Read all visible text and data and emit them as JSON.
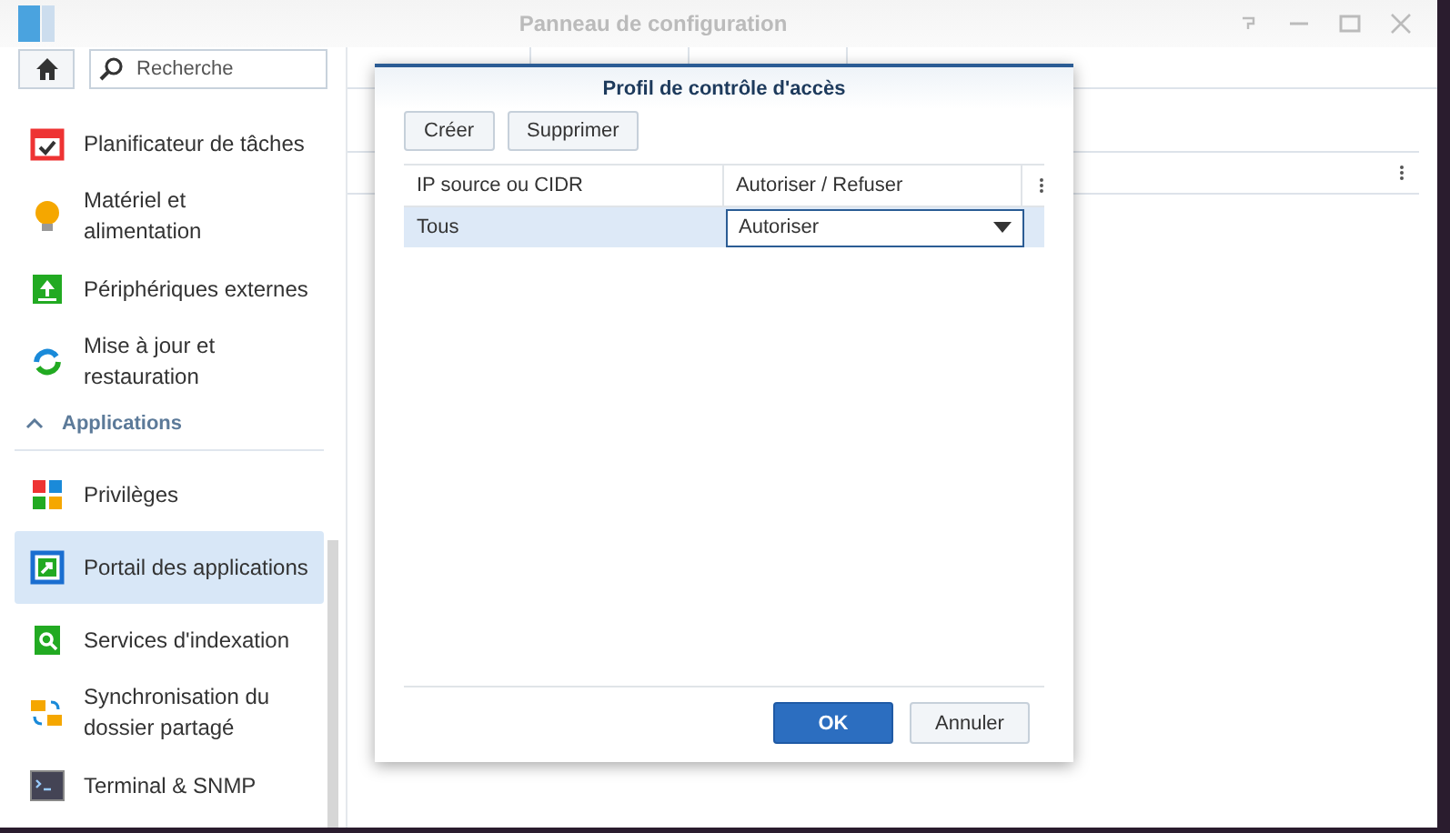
{
  "window": {
    "title": "Panneau de configuration"
  },
  "sidebar": {
    "search": {
      "placeholder": "Recherche"
    },
    "items": [
      {
        "kind": "item",
        "label": "Planificateur de tâches",
        "selected": false
      },
      {
        "kind": "item",
        "label": "Matériel et alimentation",
        "selected": false
      },
      {
        "kind": "item",
        "label": "Périphériques externes",
        "selected": false
      },
      {
        "kind": "item",
        "label": "Mise à jour et restauration",
        "selected": false
      },
      {
        "kind": "section",
        "label": "Applications",
        "expanded": true
      },
      {
        "kind": "item",
        "label": "Privilèges",
        "selected": false
      },
      {
        "kind": "item",
        "label": "Portail des applications",
        "selected": true
      },
      {
        "kind": "item",
        "label": "Services d'indexation",
        "selected": false
      },
      {
        "kind": "item",
        "label": "Synchronisation du dossier partagé",
        "selected": false
      },
      {
        "kind": "item",
        "label": "Terminal & SNMP",
        "selected": false
      }
    ]
  },
  "dialog": {
    "title": "Profil de contrôle d'accès",
    "toolbar": [
      "Créer",
      "Supprimer"
    ],
    "columns": [
      "IP source ou CIDR",
      "Autoriser / Refuser"
    ],
    "rows": [
      {
        "source": "Tous",
        "action": "Autoriser",
        "selected": true
      }
    ],
    "buttons": [
      {
        "label": "OK",
        "kind": "primary"
      },
      {
        "label": "Annuler",
        "kind": "secondary"
      }
    ]
  }
}
